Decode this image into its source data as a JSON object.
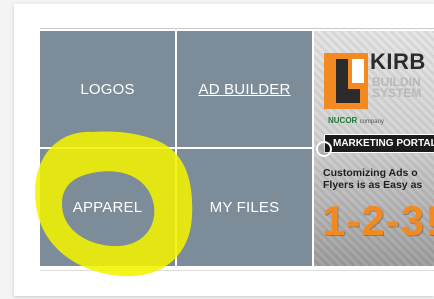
{
  "tiles": [
    {
      "label": "LOGOS"
    },
    {
      "label": "AD BUILDER"
    },
    {
      "label": "APPAREL"
    },
    {
      "label": "MY FILES"
    }
  ],
  "promo": {
    "brand_title": "KIRB",
    "brand_subtitle_line1": "BUILDIN",
    "brand_subtitle_line2": "SYSTEM",
    "parent_company": "NUCOR",
    "parent_company_suffix": "company",
    "banner": "MARKETING PORTAL",
    "copy_line1": "Customizing Ads o",
    "copy_line2": "Flyers is as Easy as",
    "headline": "1-2-3!"
  },
  "colors": {
    "tile_background": "#7c8c98",
    "accent_orange": "#f38a21",
    "highlighter": "#f2f200"
  }
}
